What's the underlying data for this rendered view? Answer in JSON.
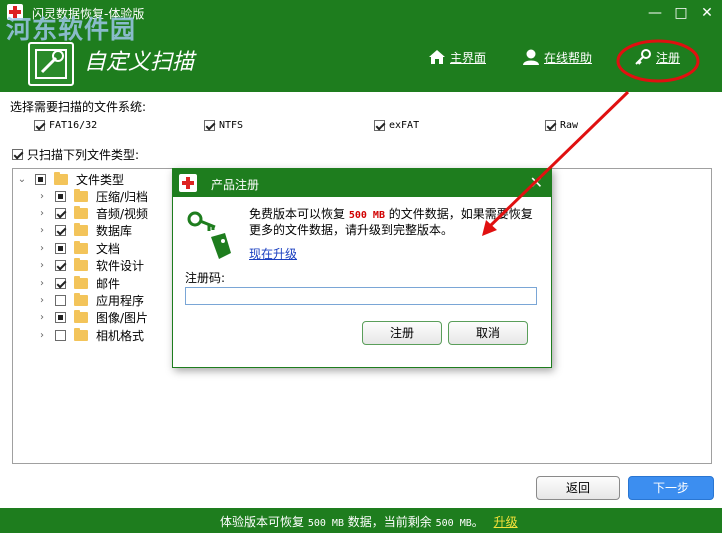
{
  "window": {
    "title": "闪灵数据恢复-体验版",
    "controls": {
      "minimize": "—",
      "maximize": "□",
      "close": "✕"
    }
  },
  "watermark": "河东软件园",
  "header": {
    "heading": "自定义扫描",
    "nav": [
      {
        "label": "主界面",
        "icon": "home-icon"
      },
      {
        "label": "在线帮助",
        "icon": "person-icon"
      },
      {
        "label": "注册",
        "icon": "key-icon"
      }
    ]
  },
  "filesystems": {
    "title": "选择需要扫描的文件系统:",
    "items": [
      {
        "label": "FAT16/32",
        "checked": true
      },
      {
        "label": "NTFS",
        "checked": true
      },
      {
        "label": "exFAT",
        "checked": true
      },
      {
        "label": "Raw",
        "checked": true
      }
    ]
  },
  "file_types": {
    "only_label": "只扫描下列文件类型:",
    "only_checked": true,
    "root": {
      "label": "文件类型",
      "state": "partial"
    },
    "items": [
      {
        "label": "压缩/归档",
        "state": "partial"
      },
      {
        "label": "音频/视频",
        "state": "checked"
      },
      {
        "label": "数据库",
        "state": "checked"
      },
      {
        "label": "文档",
        "state": "partial"
      },
      {
        "label": "软件设计",
        "state": "checked"
      },
      {
        "label": "邮件",
        "state": "checked"
      },
      {
        "label": "应用程序",
        "state": "unchecked"
      },
      {
        "label": "图像/图片",
        "state": "partial"
      },
      {
        "label": "相机格式",
        "state": "unchecked"
      }
    ]
  },
  "dialog": {
    "title": "产品注册",
    "close": "✕",
    "message_before": "免费版本可以恢复",
    "message_amount": "500 MB",
    "message_after": "的文件数据，如果需要恢复更多的文件数据，请升级到完整版本。",
    "upgrade_link": "现在升级",
    "code_label": "注册码:",
    "code_value": "",
    "register_button": "注册",
    "cancel_button": "取消"
  },
  "footer": {
    "back_button": "返回",
    "next_button": "下一步"
  },
  "status": {
    "text_a": "体验版本可恢复",
    "amount_a": "500 MB",
    "text_b": "数据，当前剩余",
    "amount_b": "500 MB",
    "text_c": "。",
    "link": "升级"
  },
  "colors": {
    "primary_green": "#1e7d1e",
    "button_blue": "#3c8ef0",
    "annotation_red": "#e01010",
    "link_yellow": "#f6e23a"
  }
}
